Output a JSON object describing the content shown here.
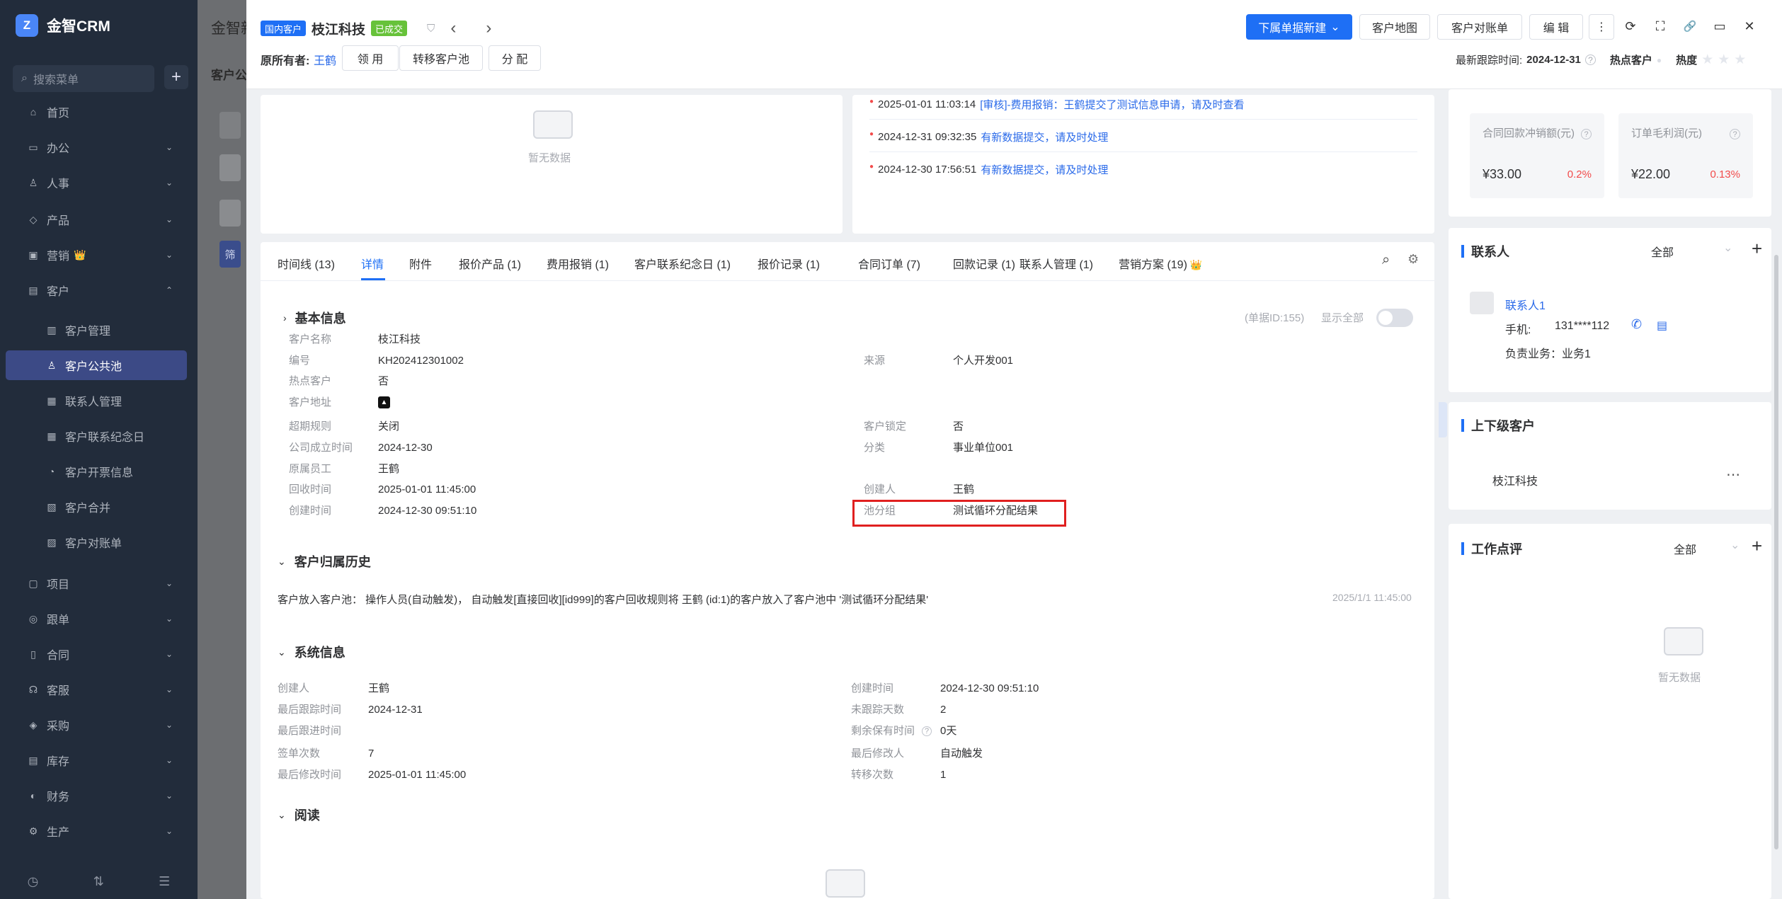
{
  "sidebar": {
    "logo_mark": "Z",
    "app_name": "金智CRM",
    "search_placeholder": "搜索菜单",
    "add_glyph": "+",
    "items": [
      {
        "label": "首页",
        "icon": "home-icon",
        "glyph": "⌂"
      },
      {
        "label": "办公",
        "icon": "office-icon",
        "glyph": "▭",
        "chevron": "⌄"
      },
      {
        "label": "人事",
        "icon": "person-icon",
        "glyph": "♙",
        "chevron": "⌄"
      },
      {
        "label": "产品",
        "icon": "product-icon",
        "glyph": "◇",
        "chevron": "⌄"
      },
      {
        "label": "营销",
        "icon": "marketing-icon",
        "glyph": "▣",
        "chevron": "⌄",
        "badge": "👑"
      },
      {
        "label": "客户",
        "icon": "customer-icon",
        "glyph": "▤",
        "chevron": "⌃"
      },
      {
        "label": "客户管理",
        "icon": "customer-manage-icon",
        "glyph": "▥"
      },
      {
        "label": "客户公共池",
        "icon": "customer-pool-icon",
        "glyph": "♙"
      },
      {
        "label": "联系人管理",
        "icon": "contact-manage-icon",
        "glyph": "▦"
      },
      {
        "label": "客户联系纪念日",
        "icon": "anniversary-icon",
        "glyph": "▦"
      },
      {
        "label": "客户开票信息",
        "icon": "invoice-icon",
        "glyph": "◔"
      },
      {
        "label": "客户合并",
        "icon": "merge-icon",
        "glyph": "▧"
      },
      {
        "label": "客户对账单",
        "icon": "statement-icon",
        "glyph": "▨"
      },
      {
        "label": "项目",
        "icon": "project-icon",
        "glyph": "▢",
        "chevron": "⌄"
      },
      {
        "label": "跟单",
        "icon": "follow-icon",
        "glyph": "◎",
        "chevron": "⌄"
      },
      {
        "label": "合同",
        "icon": "contract-icon",
        "glyph": "▯",
        "chevron": "⌄"
      },
      {
        "label": "客服",
        "icon": "service-icon",
        "glyph": "☊",
        "chevron": "⌄"
      },
      {
        "label": "采购",
        "icon": "purchase-icon",
        "glyph": "◈",
        "chevron": "⌄"
      },
      {
        "label": "库存",
        "icon": "stock-icon",
        "glyph": "▤",
        "chevron": "⌄"
      },
      {
        "label": "财务",
        "icon": "finance-icon",
        "glyph": "◐",
        "chevron": "⌄"
      },
      {
        "label": "生产",
        "icon": "production-icon",
        "glyph": "⚙",
        "chevron": "⌄"
      }
    ],
    "bottom_glyphs": [
      "◷",
      "⇅",
      "☰"
    ]
  },
  "background": {
    "title": "金智新",
    "subtitle": "客户公",
    "filter_btn": "筛"
  },
  "header": {
    "tag_domestic": "国内客户",
    "customer_name": "枝江科技",
    "tag_deal": "已成交",
    "owner_label": "原所有者:",
    "owner_name": "王鹤",
    "btn_claim": "领 用",
    "btn_transfer": "转移客户池",
    "btn_assign": "分 配",
    "btn_new_sub": "下属单据新建",
    "btn_map": "客户地图",
    "btn_statement": "客户对账单",
    "btn_edit": "编 辑",
    "last_follow_label": "最新跟踪时间:",
    "last_follow_value": "2024-12-31",
    "hot_label": "热点客户",
    "heat_label": "热度",
    "stars": "★★★",
    "glyphs": {
      "chevron": "⌄",
      "shield": "⛉",
      "prev": "‹",
      "next": "›",
      "more": "⋮",
      "refresh": "⟳",
      "fullscreen": "⛶",
      "link": "🔗",
      "panel": "▭",
      "close": "✕",
      "help": "?",
      "dot": "●"
    }
  },
  "left_empty": {
    "text": "暂无数据"
  },
  "messages": [
    {
      "time": "2025-01-01 11:03:14",
      "text": "[审核]-费用报销：王鹤提交了测试信息申请，请及时查看"
    },
    {
      "time": "2024-12-31 09:32:35",
      "text": "有新数据提交，请及时处理"
    },
    {
      "time": "2024-12-30 17:56:51",
      "text": "有新数据提交，请及时处理"
    }
  ],
  "tabs": [
    "时间线 (13)",
    "详情",
    "附件",
    "报价产品 (1)",
    "费用报销 (1)",
    "客户联系纪念日 (1)",
    "报价记录 (1)",
    "合同订单 (7)",
    "回款记录 (1)",
    "联系人管理 (1)",
    "营销方案 (19)"
  ],
  "tab_crown": "👑",
  "tab_tools": {
    "search": "⌕",
    "settings": "⚙"
  },
  "basic": {
    "title": "基本信息",
    "doc_id": "(单据ID:155)",
    "show_all": "显示全部",
    "arrow_collapsed": "›",
    "arrow_expanded": "⌄",
    "left": [
      {
        "label": "客户名称",
        "value": "枝江科技"
      },
      {
        "label": "编号",
        "value": "KH202412301002"
      },
      {
        "label": "热点客户",
        "value": "否"
      },
      {
        "label": "客户地址",
        "value": "▲"
      },
      {
        "label": "超期规则",
        "value": "关闭"
      },
      {
        "label": "公司成立时间",
        "value": "2024-12-30"
      },
      {
        "label": "原属员工",
        "value": "王鹤"
      },
      {
        "label": "回收时间",
        "value": "2025-01-01 11:45:00"
      },
      {
        "label": "创建时间",
        "value": "2024-12-30 09:51:10"
      }
    ],
    "right": [
      {
        "label": "来源",
        "value": "个人开发001"
      },
      {
        "label": "客户锁定",
        "value": "否"
      },
      {
        "label": "分类",
        "value": "事业单位001"
      },
      {
        "label": "创建人",
        "value": "王鹤"
      },
      {
        "label": "池分组",
        "value": "测试循环分配结果"
      }
    ]
  },
  "history": {
    "title": "客户归属历史",
    "text": "客户放入客户池：  操作人员(自动触发)，  自动触发[直接回收][id999]的客户回收规则将 王鹤 (id:1)的客户放入了客户池中 '测试循环分配结果'",
    "time": "2025/1/1 11:45:00"
  },
  "system": {
    "title": "系统信息",
    "left": [
      {
        "label": "创建人",
        "value": "王鹤"
      },
      {
        "label": "最后跟踪时间",
        "value": "2024-12-31"
      },
      {
        "label": "最后跟进时间",
        "value": ""
      },
      {
        "label": "签单次数",
        "value": "7"
      },
      {
        "label": "最后修改时间",
        "value": "2025-01-01 11:45:00"
      }
    ],
    "right": [
      {
        "label": "创建时间",
        "value": "2024-12-30 09:51:10"
      },
      {
        "label": "未跟踪天数",
        "value": "2"
      },
      {
        "label": "剩余保有时间",
        "value": "0天"
      },
      {
        "label": "最后修改人",
        "value": "自动触发"
      },
      {
        "label": "转移次数",
        "value": "1"
      }
    ]
  },
  "read": {
    "title": "阅读"
  },
  "stats": [
    {
      "label": "合同回款冲销额(元)",
      "value": "¥33.00",
      "pct": "0.2%"
    },
    {
      "label": "订单毛利润(元)",
      "value": "¥22.00",
      "pct": "0.13%"
    }
  ],
  "contacts": {
    "title": "联系人",
    "filter": "全部",
    "add": "+",
    "name": "联系人1",
    "phone_label": "手机:",
    "phone": "131****112",
    "business": "负责业务：业务1",
    "phone_glyph": "✆",
    "msg_glyph": "▤"
  },
  "parent_child": {
    "title": "上下级客户",
    "name": "枝江科技",
    "more": "⋯"
  },
  "work_review": {
    "title": "工作点评",
    "filter": "全部",
    "add": "+",
    "empty": "暂无数据"
  }
}
